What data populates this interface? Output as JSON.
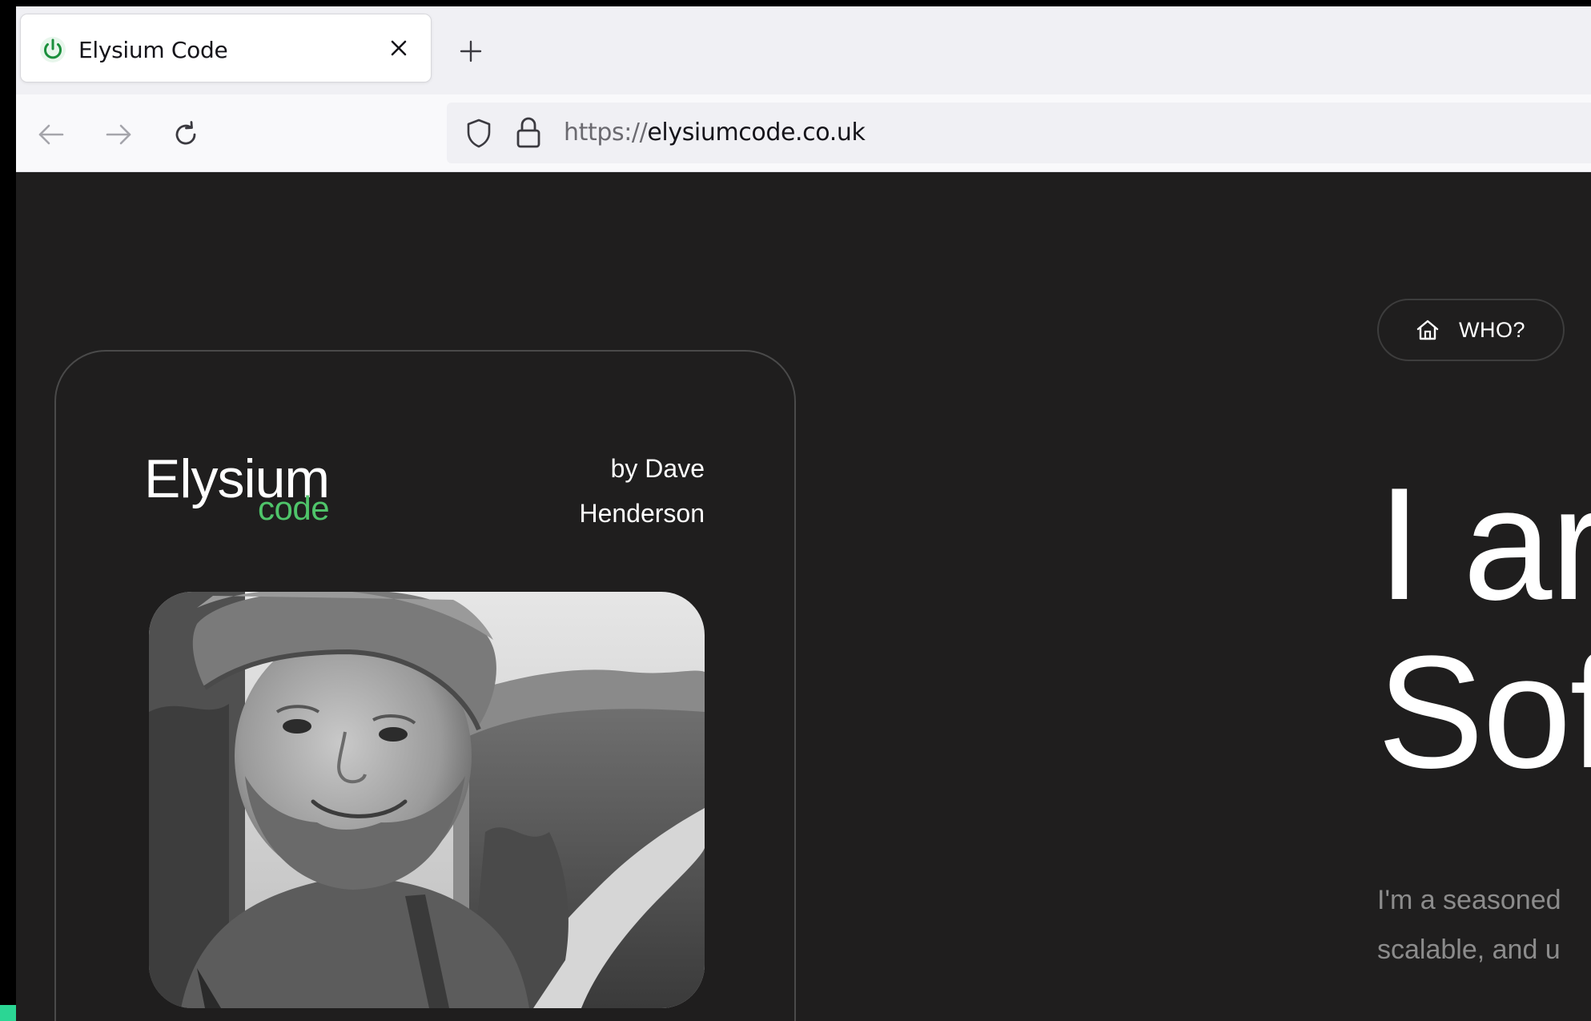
{
  "browser": {
    "tab": {
      "title": "Elysium Code",
      "favicon": "power-icon",
      "close_icon": "close-icon"
    },
    "new_tab_icon": "plus-icon",
    "nav": {
      "back_icon": "arrow-left-icon",
      "forward_icon": "arrow-right-icon",
      "reload_icon": "reload-icon"
    },
    "url": {
      "scheme": "https://",
      "host": "elysiumcode.co.uk",
      "shield_icon": "shield-icon",
      "lock_icon": "lock-icon"
    }
  },
  "page": {
    "nav_pill": {
      "icon": "home-icon",
      "label": "WHO?"
    },
    "card": {
      "logo_main": "Elysium",
      "logo_sub": "code",
      "byline_line1": "by Dave",
      "byline_line2": "Henderson",
      "photo_alt": "portrait"
    },
    "headline_line1": "I ar",
    "headline_line2": "Sof",
    "intro_line1": "I'm a seasoned",
    "intro_line2": "scalable, and u"
  },
  "colors": {
    "page_bg": "#1f1e1e",
    "accent_green": "#4fc46a",
    "text_primary": "#ffffff",
    "text_muted": "#8c8c8c",
    "chrome_bg": "#f0f0f4"
  }
}
